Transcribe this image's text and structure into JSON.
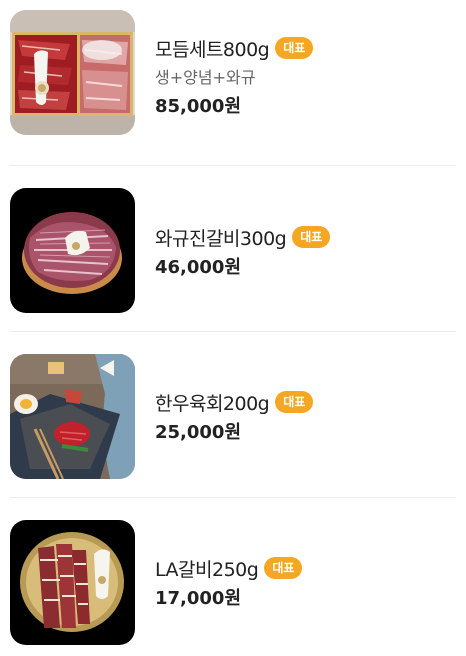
{
  "menu": {
    "items": [
      {
        "name": "모듬세트800g",
        "badge": "대표",
        "description": "생+양념+와규",
        "price": "85,000원",
        "image_icon": "mixed-beef-platter-image"
      },
      {
        "name": "와규진갈비300g",
        "badge": "대표",
        "description": "",
        "price": "46,000원",
        "image_icon": "wagyu-ribs-platter-image"
      },
      {
        "name": "한우육회200g",
        "badge": "대표",
        "description": "",
        "price": "25,000원",
        "image_icon": "beef-tartare-image"
      },
      {
        "name": "LA갈비250g",
        "badge": "대표",
        "description": "",
        "price": "17,000원",
        "image_icon": "la-ribs-platter-image"
      }
    ]
  },
  "colors": {
    "badge_bg": "#f5a623",
    "badge_text": "#ffffff",
    "divider": "#ececec",
    "price_text": "#222222",
    "desc_text": "#666666"
  }
}
